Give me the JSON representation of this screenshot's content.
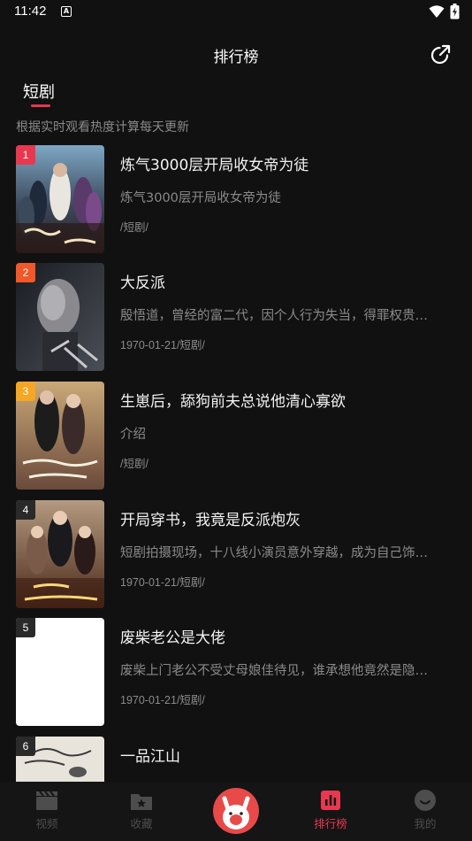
{
  "status": {
    "time": "11:42",
    "a_label": "A"
  },
  "header": {
    "title": "排行榜"
  },
  "tab": {
    "label": "短剧"
  },
  "subtitle": "根据实时观看热度计算每天更新",
  "items": [
    {
      "rank": "1",
      "title": "炼气3000层开局收女帝为徒",
      "desc": "炼气3000层开局收女帝为徒",
      "meta": "/短剧/",
      "rank_color": "#e8384f"
    },
    {
      "rank": "2",
      "title": "大反派",
      "desc": "殷悟道，曾经的富二代，因个人行为失当，得罪权贵…",
      "meta": "1970-01-21/短剧/",
      "rank_color": "#f0582a"
    },
    {
      "rank": "3",
      "title": "生崽后，舔狗前夫总说他清心寡欲",
      "desc": "介绍",
      "meta": "/短剧/",
      "rank_color": "#f5a623"
    },
    {
      "rank": "4",
      "title": "开局穿书，我竟是反派炮灰",
      "desc": "短剧拍摄现场，十八线小演员意外穿越，成为自己饰…",
      "meta": "1970-01-21/短剧/",
      "rank_color": "#2a2a2a"
    },
    {
      "rank": "5",
      "title": "废柴老公是大佬",
      "desc": "废柴上门老公不受丈母娘佳待见，谁承想他竟然是隐…",
      "meta": "1970-01-21/短剧/",
      "rank_color": "#2a2a2a"
    },
    {
      "rank": "6",
      "title": "一品江山",
      "desc": "",
      "meta": "",
      "rank_color": "#2a2a2a"
    }
  ],
  "nav": {
    "video": "视频",
    "favorites": "收藏",
    "ranking": "排行榜",
    "mine": "我的"
  },
  "colors": {
    "accent": "#e8384f",
    "background": "#111111",
    "muted": "#8a8a8a"
  }
}
